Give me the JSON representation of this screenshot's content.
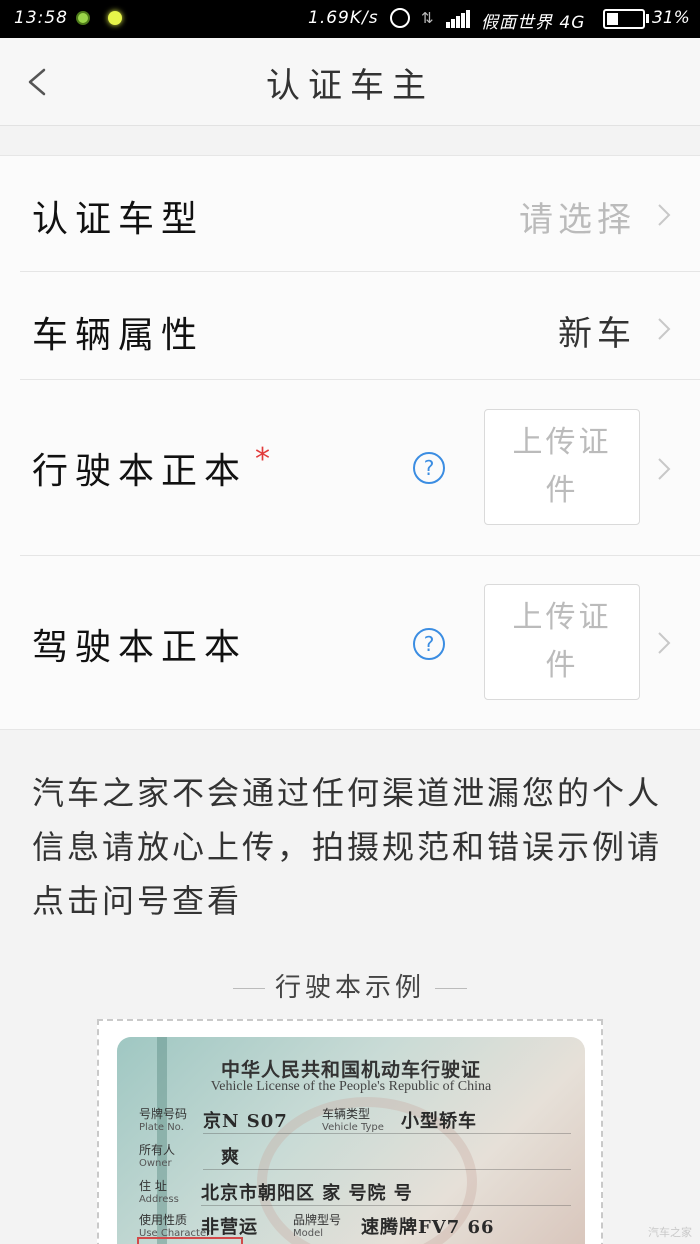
{
  "status_bar": {
    "time": "13:58",
    "net_speed": "1.69K/s",
    "carrier": "假面世界 4G",
    "battery_percent": 31,
    "battery_label": "31%"
  },
  "nav": {
    "title": "认证车主"
  },
  "form": {
    "rows": [
      {
        "label": "认证车型",
        "value": "请选择"
      },
      {
        "label": "车辆属性",
        "value": "新车"
      },
      {
        "label": "行驶本正本",
        "required_mark": "*",
        "help": "?",
        "upload": "上传证件"
      },
      {
        "label": "驾驶本正本",
        "help": "?",
        "upload": "上传证件"
      }
    ]
  },
  "notice": "汽车之家不会通过任何渠道泄漏您的个人信息请放心上传，拍摄规范和错误示例请点击问号查看",
  "example": {
    "title": "行驶本示例",
    "license": {
      "title": "中华人民共和国机动车行驶证",
      "subtitle": "Vehicle License of the People's Republic of China",
      "fields": [
        {
          "cn": "号牌号码",
          "en": "Plate No.",
          "value": "京N S07"
        },
        {
          "cn": "车辆类型",
          "en": "Vehicle Type",
          "value": "小型轿车"
        },
        {
          "cn": "所有人",
          "en": "Owner",
          "value": "爽"
        },
        {
          "cn": "住 址",
          "en": "Address",
          "value": "北京市朝阳区 家 号院 号"
        },
        {
          "cn": "使用性质",
          "en": "Use Character",
          "value": "非营运"
        },
        {
          "cn": "品牌型号",
          "en": "Model",
          "value": "速腾牌FV7 66"
        }
      ]
    }
  },
  "watermark": "汽车之家",
  "colors": {
    "accent": "#3b8de2",
    "required": "#e23b3b",
    "placeholder": "#bbbbbb"
  }
}
